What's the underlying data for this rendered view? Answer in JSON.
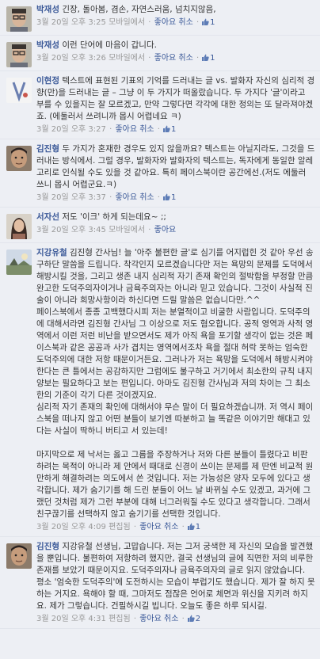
{
  "comments": [
    {
      "author": "박재성",
      "paragraphs": [
        "긴장, 돌아봄, 겸손, 자연스러움, 넘치지않음,"
      ],
      "time": "3월 20일 오후 3:25",
      "via": "모바일에서",
      "actions": [
        "좋아요 취소"
      ],
      "likes": "1",
      "avatar": "glasses"
    },
    {
      "author": "박재성",
      "paragraphs": [
        "이런 단어에 마음이 갑니다."
      ],
      "time": "3월 20일 오후 3:26",
      "via": "모바일에서",
      "actions": [
        "좋아요 취소"
      ],
      "likes": "1",
      "avatar": "glasses"
    },
    {
      "author": "이현정",
      "paragraphs": [
        "텍스트에 표현된 기표의 기억를 드러내는 글 vs. 발화자 자신의 심리적 경향(만)을 드러내는 글 – 그냥 이 두 가지가 떠올랐습니다. 두 가지다 '글'이라고 부를 수 있을지는 잘 모르겠고, 만약 그렇다면 각각에 대한 정의는 또 달라져야겠죠. (에둘러서 쓰려니까 몹시 어렵네요 ㅋ)"
      ],
      "time": "3월 20일 오후 3:27",
      "via": "",
      "actions": [
        "좋아요 취소"
      ],
      "likes": "1",
      "avatar": "logo"
    },
    {
      "author": "김진형",
      "paragraphs": [
        "두 가지가 혼재한 경우도 있지 않을까요? 텍스트는 아닐지라도, 그것을 드러내는 방식에서. 그럴 경우, 발화자와 발화자의 텍스트는, 독자에게 동일한 알레고리로 인식될 수도 있을 것 같아요. 특히 페이스북이란 공간에선.(저도 에둘러 쓰니 몹시 어렵군요.ㅋ)"
      ],
      "time": "3월 20일 오후 3:37",
      "via": "",
      "actions": [
        "좋아요 취소"
      ],
      "likes": "1",
      "avatar": "face"
    },
    {
      "author": "서자선",
      "paragraphs": [
        "저도 '이크' 하게 되는데요~ ;;"
      ],
      "time": "3월 20일 오후 3:45",
      "via": "모바일에서",
      "actions": [
        "좋아요"
      ],
      "likes": "",
      "avatar": "woman"
    },
    {
      "author": "지강유철",
      "paragraphs": [
        "김진형 간사님! 늘 '아주 불편한 글'로 심기를 어지럽힌 것 같아 우선 송구하단 말씀을 드립니다. 착각인지 모르겠습니다만 저는 욕망의 문제를 도덕에서 해방시킬 것을, 그리고 생존 내지 심리적 자기 존재 확인의 절박함을 부정할 만큼 완고한 도덕주의자이거나 금욕주의자는 아니라 믿고 있습니다. 그것이 사실적 진술이 아니라 희망사항이라 하신다면 드릴 말씀은 없습니다만.^^",
        "페이스북에서 종종 고백했다시피 저는 분열적이고 비굴한 사람입니다. 도덕주의에 대해서라면 김진형 간사님 그 이상으로 저도 혐오합니다. 공적 영역과 사적 영역에서 이런 저런 비난을 받으면서도 제가 아직 욕을 포기할 생각이 없는 것은 페이스북과 같은 공공과 사가 겹치는 영역에서조차 욕을 절대 허락 못하는 엄숙한 도덕주의에 대한 저항 때문이거든요. 그러나가 저는 욕망을 도덕에서 해방시켜야 한다는 큰 틀에서는 공감하지만 그럼에도 불구하고 거기에서 최소한의 규칙 내지 양보는 필요하다고 보는 편입니다. 아마도 김진형 간사님과 저의 차이는 그 최소한의 기준이 각기 다른 것이겠지요.",
        "심리적 자기 존재의 확인에 대해서야 무슨 말이 더 필요하겠습니까. 저 역시 페이스북을 떠나지 않고 어떤 분들이 보기엔 따분하고 늘 똑같은 이야기만 해대고 있다는 사실이 딱하니 버티고 서 있는데!",
        "",
        "마지막으로 제 낙서는 옳고 그름을 주장하거나 저와 다른 분들이 틀렸다고 비판하려는 목적이 아니라 제 안에서 때대로 신경이 쓰이는 문제를 제 딴엔 비교적 원만하게 해결하려는 의도에서 쓴 것입니다. 저는 가능성은 양자 모두에 있다고 생각합니다. 제가 숨기기를 해 드린 분들이 어느 날 바뀌실 수도 있겠고, 과거에 그랬던 것처럼 제가 그런 부분에 대해 너그러워질 수도 있다고 생각합니다. 그래서 친구끊기를 선택하지 않고 숨기기를 선택한 것입니다."
      ],
      "time": "3월 20일 오후 4:09",
      "via": "편집됨",
      "actions": [
        "좋아요 취소"
      ],
      "likes": "1",
      "avatar": "landscape"
    },
    {
      "author": "김진형",
      "paragraphs": [
        "지강유철 선생님, 고맙습니다. 저는 그저 궁색한 제 자신의 모습을 발견했을 뿐입니다. 불편하여 저항하려 했지만, 결국 선생님의 글에 직면한 저의 비루한 존재를 보았기 때문이지요. 도덕주의자나 금욕주의자의 글로 읽지 않았습니다. 평소 '엄숙한 도덕주의'에 도전하시는 모습이 부럽기도 했습니다. 제가 잘 하지 못하는 거지요. 욕해야 할 때, 그마저도 점잖은 언어로 체면과 위신을 지키려 하지요. 제가 그렇습니다. 건필하시길 빕니다. 오늘도 좋은 하루 되시길."
      ],
      "time": "3월 20일 오후 4:31",
      "via": "편집됨",
      "actions": [
        "좋아요 취소"
      ],
      "likes": "2",
      "avatar": "face"
    }
  ]
}
